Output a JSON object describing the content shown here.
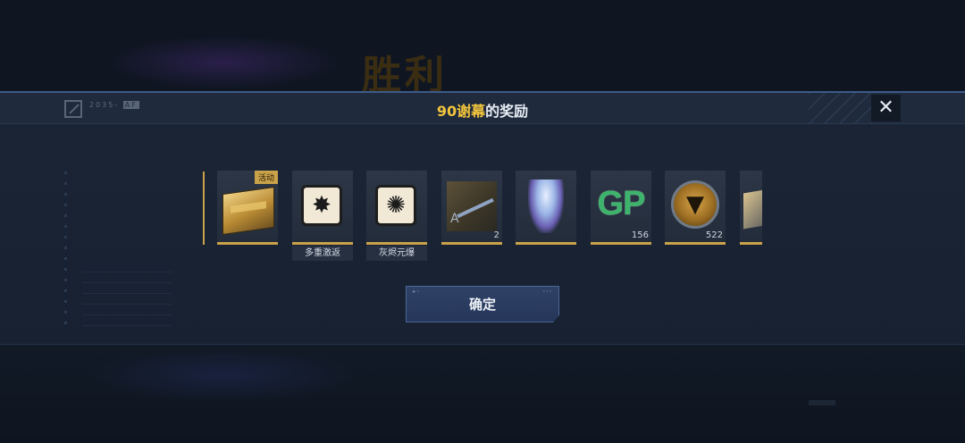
{
  "background": {
    "title": "胜利"
  },
  "header": {
    "logo_code": "2035-",
    "logo_tag": "AF",
    "title_accent": "90谢幕",
    "title_rest": "的奖励",
    "close_glyph": "✕"
  },
  "rewards": [
    {
      "icon": "gold-chest-icon",
      "badge": "活动",
      "name": "",
      "count": ""
    },
    {
      "icon": "explosion-skill-icon",
      "badge": "",
      "name": "多重激返",
      "count": ""
    },
    {
      "icon": "gear-bomb-skill-icon",
      "badge": "",
      "name": "灰烬元爆",
      "count": ""
    },
    {
      "icon": "rifle-icon",
      "badge": "",
      "name": "",
      "count": "2"
    },
    {
      "icon": "spirit-pet-icon",
      "badge": "",
      "name": "",
      "count": ""
    },
    {
      "icon": "gp-currency-icon",
      "badge": "",
      "name": "",
      "count": "156"
    },
    {
      "icon": "medal-icon",
      "badge": "",
      "name": "",
      "count": "522"
    },
    {
      "icon": "partial-reward-icon",
      "badge": "",
      "name": "",
      "count": ""
    }
  ],
  "confirm": {
    "label": "确定"
  },
  "colors": {
    "accent_gold": "#f2c53d",
    "frame_gold": "#c9a24a",
    "button_blue": "#2f4266",
    "gp_green": "#3db36b"
  }
}
